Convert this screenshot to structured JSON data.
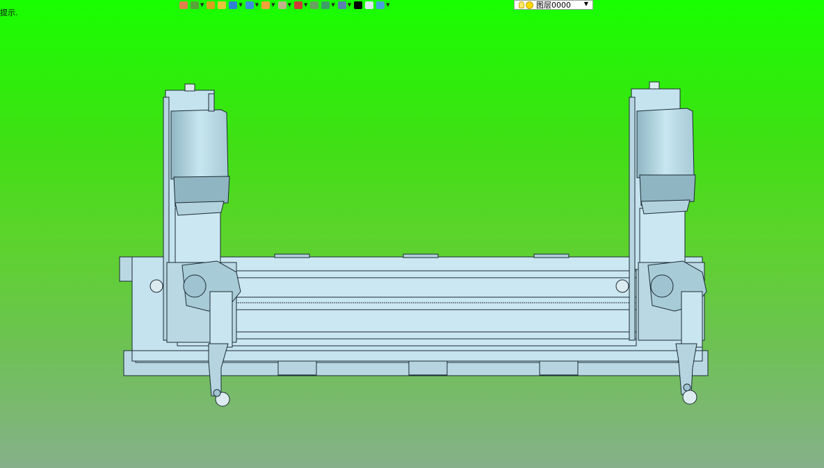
{
  "status": {
    "hint": "提示."
  },
  "toolbar": {
    "buttons": [
      {
        "name": "undo-icon",
        "color": "#e0804a",
        "dropdown": false
      },
      {
        "name": "tree-icon",
        "color": "#5aa23a",
        "dropdown": true
      },
      {
        "name": "pencil-icon",
        "color": "#d9a020",
        "dropdown": false
      },
      {
        "name": "layers-icon",
        "color": "#e7c23a",
        "dropdown": false
      },
      {
        "name": "cube-icon",
        "color": "#2f7fd6",
        "dropdown": true
      },
      {
        "name": "box-view-icon",
        "color": "#3b8ee0",
        "dropdown": true
      },
      {
        "name": "render-mode-icon",
        "color": "#f0a23a",
        "dropdown": true
      },
      {
        "name": "zoom-fit-icon",
        "color": "#c0b28a",
        "dropdown": true
      },
      {
        "name": "snap-icon",
        "color": "#d03a3a",
        "dropdown": true
      },
      {
        "name": "select-filter-icon",
        "color": "#6aa060",
        "dropdown": false
      },
      {
        "name": "frame-icon",
        "color": "#3c9e6a",
        "dropdown": true
      },
      {
        "name": "display-icon",
        "color": "#5a7fb0",
        "dropdown": true
      },
      {
        "name": "line-color-icon",
        "color": "#000000",
        "dropdown": false
      },
      {
        "name": "fill-color-icon",
        "color": "#dde6ef",
        "dropdown": false
      },
      {
        "name": "layer-manager-icon",
        "color": "#4aa0d8",
        "dropdown": true
      }
    ],
    "layer_select": {
      "value": "图层0000",
      "icon_bulb": "bulb-icon",
      "icon_state": "sun-icon"
    }
  },
  "colors": {
    "bg_top": "#18ff00",
    "bg_bottom": "#86b08a",
    "part_fill": "#c5e3ee",
    "part_shade": "#8fb6c4",
    "part_edge": "#1a2a33"
  }
}
